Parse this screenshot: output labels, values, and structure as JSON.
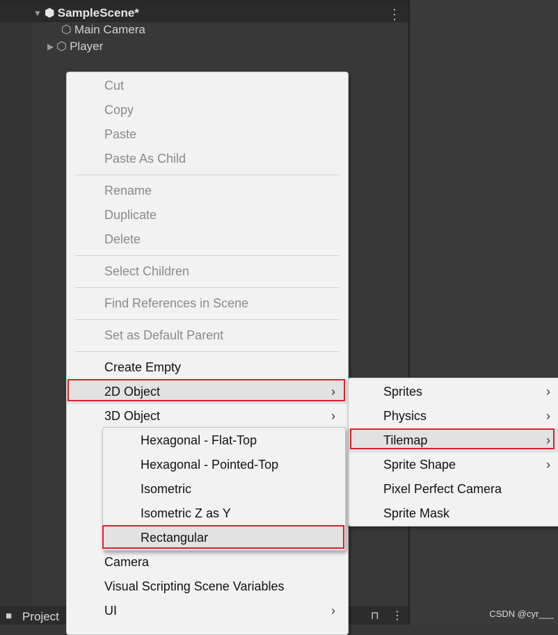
{
  "hierarchy": {
    "scene": "SampleScene*",
    "items": [
      "Main Camera",
      "Player"
    ]
  },
  "bottom": {
    "project_tab": "Project"
  },
  "context_menu": {
    "items": [
      {
        "label": "Cut",
        "disabled": true
      },
      {
        "label": "Copy",
        "disabled": true
      },
      {
        "label": "Paste",
        "disabled": true
      },
      {
        "label": "Paste As Child",
        "disabled": true
      },
      {
        "label": "Rename",
        "disabled": true
      },
      {
        "label": "Duplicate",
        "disabled": true
      },
      {
        "label": "Delete",
        "disabled": true
      },
      {
        "label": "Select Children",
        "disabled": true
      },
      {
        "label": "Find References in Scene",
        "disabled": true
      },
      {
        "label": "Set as Default Parent",
        "disabled": true
      },
      {
        "label": "Create Empty"
      },
      {
        "label": "2D Object",
        "submenu": true
      },
      {
        "label": "3D Object",
        "submenu": true
      },
      {
        "label": "Camera"
      },
      {
        "label": "Visual Scripting Scene Variables"
      },
      {
        "label": "UI",
        "submenu": true
      }
    ]
  },
  "submenu_2d": {
    "items": [
      {
        "label": "Sprites",
        "submenu": true
      },
      {
        "label": "Physics",
        "submenu": true
      },
      {
        "label": "Tilemap",
        "submenu": true
      },
      {
        "label": "Sprite Shape",
        "submenu": true
      },
      {
        "label": "Pixel Perfect Camera"
      },
      {
        "label": "Sprite Mask"
      }
    ]
  },
  "submenu_tilemap": {
    "items": [
      "Hexagonal - Flat-Top",
      "Hexagonal - Pointed-Top",
      "Isometric",
      "Isometric Z as Y",
      "Rectangular"
    ]
  },
  "watermark": "CSDN @cyr___",
  "colors": {
    "highlight_box": "#e0202a",
    "menu_bg": "#f2f2f2",
    "editor_bg": "#383838"
  }
}
